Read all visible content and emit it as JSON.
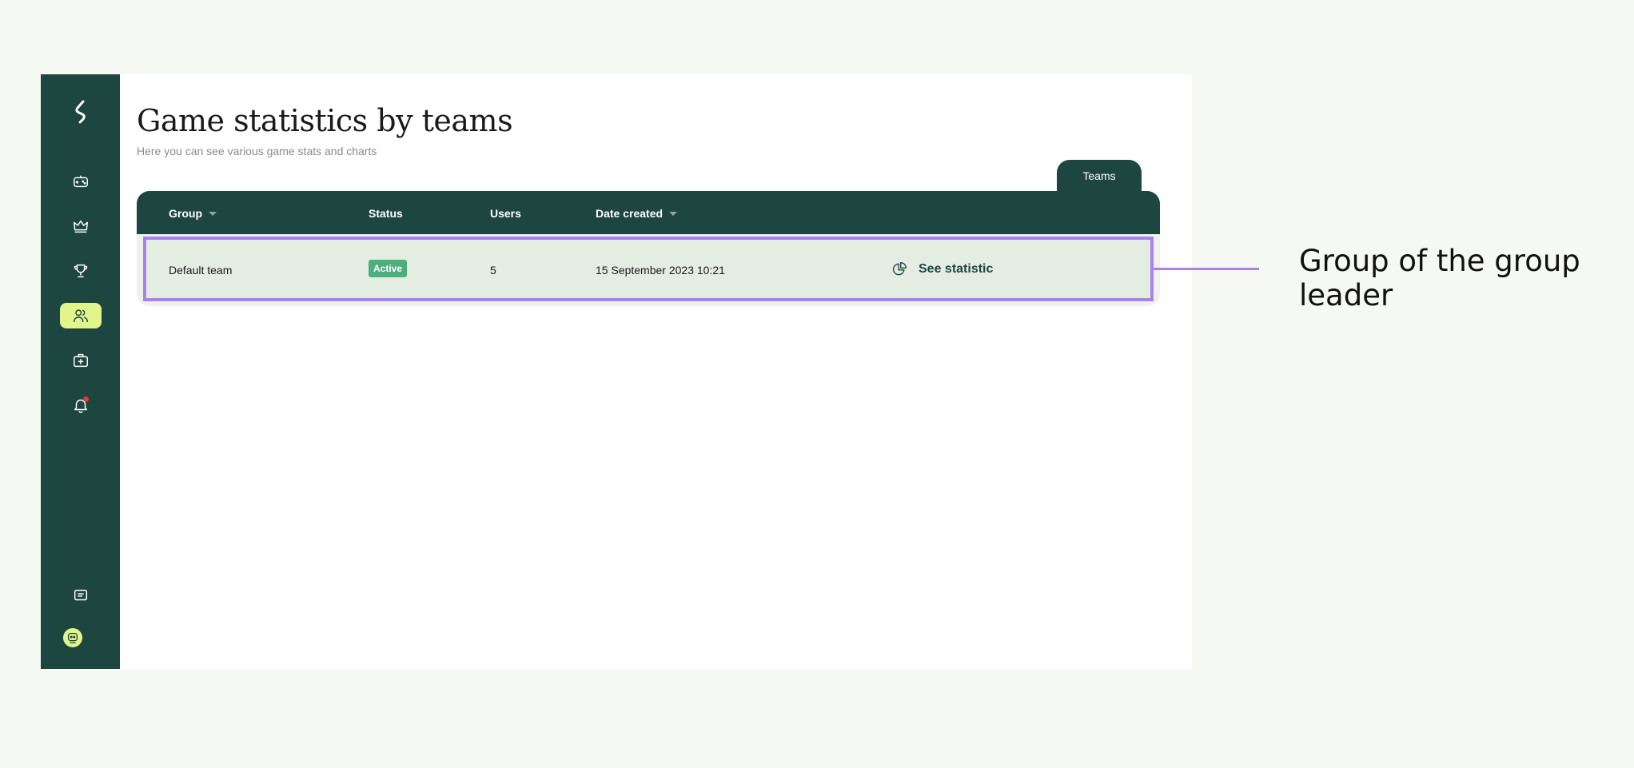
{
  "page": {
    "title": "Game statistics by teams",
    "subtitle": "Here you can see various game stats and charts"
  },
  "sidebar": {
    "items": [
      {
        "name": "games",
        "icon": "gamepad-icon",
        "active": false
      },
      {
        "name": "ranking",
        "icon": "crown-icon",
        "active": false
      },
      {
        "name": "trophies",
        "icon": "trophy-icon",
        "active": false
      },
      {
        "name": "teams",
        "icon": "users-icon",
        "active": true
      },
      {
        "name": "kit",
        "icon": "medical-bag-icon",
        "active": false
      },
      {
        "name": "notifications",
        "icon": "bell-icon",
        "active": false
      }
    ],
    "bottom": [
      {
        "name": "messages",
        "icon": "chat-icon"
      },
      {
        "name": "profile",
        "icon": "avatar-icon"
      }
    ]
  },
  "tabs": [
    {
      "label": "Teams",
      "active": true
    }
  ],
  "table": {
    "columns": {
      "group": "Group",
      "status": "Status",
      "users": "Users",
      "date_created": "Date created"
    },
    "rows": [
      {
        "group": "Default team",
        "status": "Active",
        "users": "5",
        "date_created": "15 September 2023 10:21",
        "action": "See statistic"
      }
    ]
  },
  "callout": {
    "text": "Group of the group leader"
  },
  "colors": {
    "sidebar": "#1d4641",
    "active_item": "#e2f58a",
    "highlight": "#a982ee",
    "badge": "#4caf80",
    "row_bg": "#e4ede1"
  }
}
